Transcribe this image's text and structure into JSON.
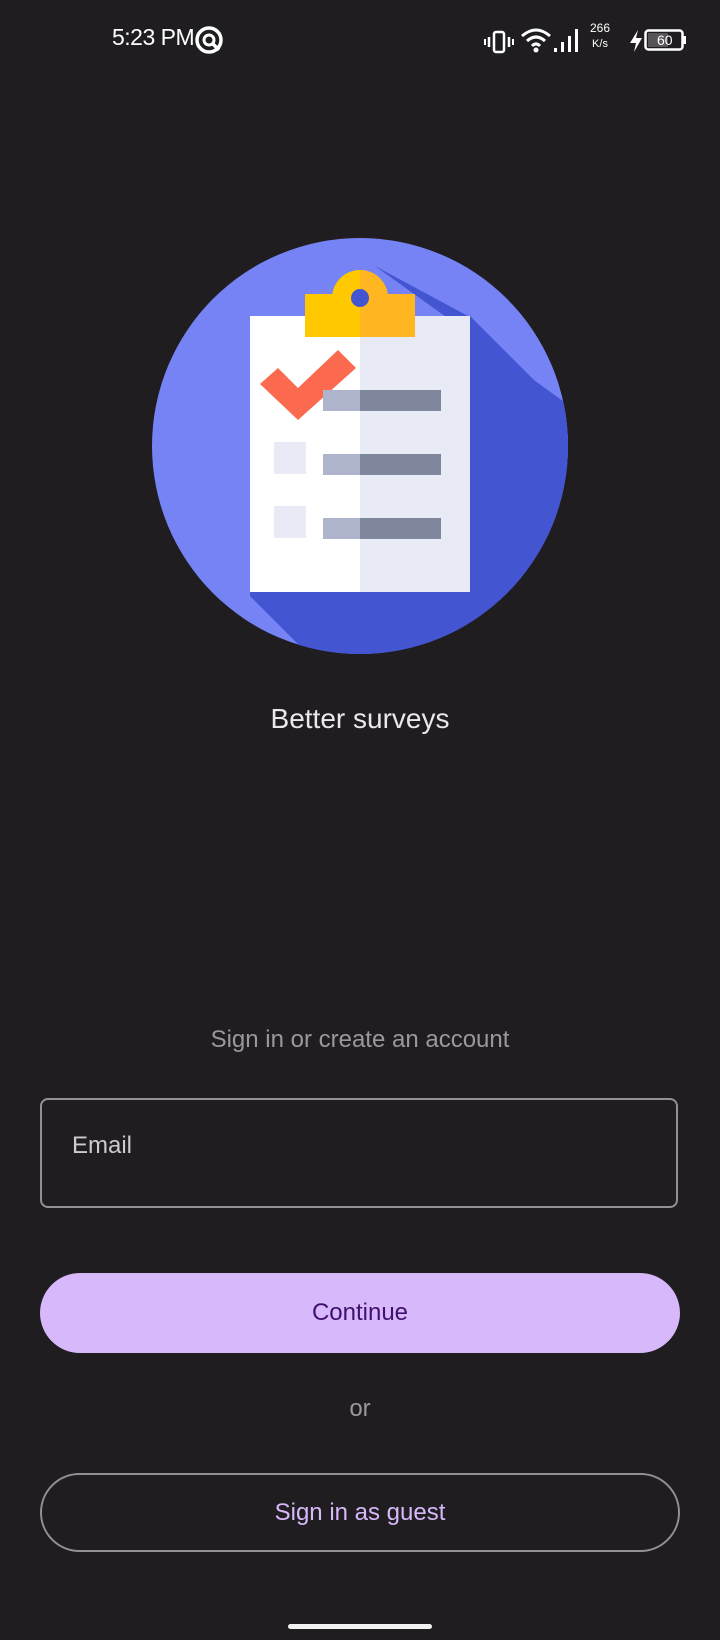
{
  "status_bar": {
    "time": "5:23 PM",
    "net_speed_value": "266",
    "net_speed_unit": "K/s",
    "battery_level": "60",
    "icons": [
      "app-notification-icon",
      "vibrate-icon",
      "wifi-icon",
      "signal-icon",
      "charging-icon",
      "battery-icon"
    ]
  },
  "hero": {
    "illustration": "clipboard-checklist-illustration",
    "tagline": "Better surveys",
    "colors": {
      "circle": "#7583f4",
      "shadow": "#4455d1",
      "clip": "#ffc800",
      "check": "#fb6a4f"
    }
  },
  "auth": {
    "prompt": "Sign in or create an account",
    "email_placeholder": "Email",
    "email_value": "",
    "continue_label": "Continue",
    "or_label": "or",
    "guest_label": "Sign in as guest"
  },
  "theme": {
    "background": "#1f1d20",
    "primary": "#d7b8fa",
    "on_primary": "#40106e",
    "outline": "#938f94"
  }
}
